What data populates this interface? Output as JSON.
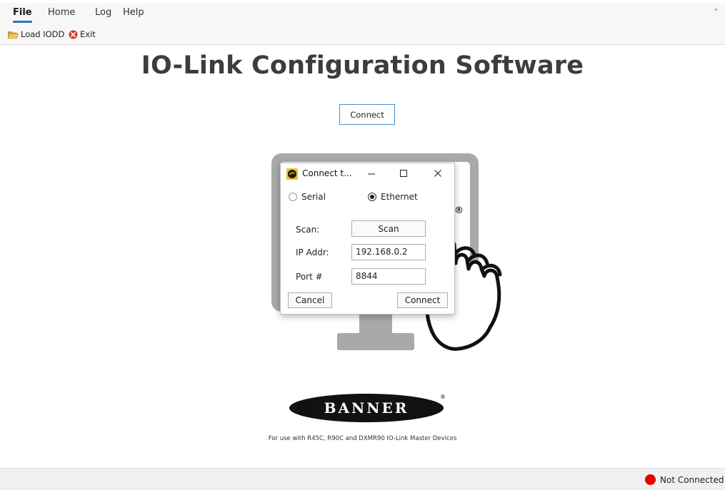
{
  "menu": {
    "tabs": [
      {
        "label": "File",
        "active": true
      },
      {
        "label": "Home",
        "active": false
      },
      {
        "label": "Log",
        "active": false
      },
      {
        "label": "Help",
        "active": false
      }
    ],
    "collapse_icon": "chevron-up-icon"
  },
  "ribbon": {
    "load_iodd": {
      "label": "Load IODD",
      "icon": "folder-open-icon"
    },
    "exit": {
      "label": "Exit",
      "icon": "exit-x-icon"
    }
  },
  "main": {
    "title": "IO-Link Configuration Software",
    "connect_button": "Connect",
    "monitor_mark": "®"
  },
  "dialog": {
    "title": "Connect t...",
    "radio_serial": {
      "label": "Serial",
      "checked": false
    },
    "radio_ethernet": {
      "label": "Ethernet",
      "checked": true
    },
    "scan_label": "Scan:",
    "scan_button": "Scan",
    "ip_label": "IP Addr:",
    "ip_value": "192.168.0.2",
    "port_label": "Port #",
    "port_value": "8844",
    "cancel_button": "Cancel",
    "connect_button": "Connect"
  },
  "footer": {
    "logo_text": "BANNER",
    "logo_mark": "®",
    "note": "For use with R45C, R90C and DXMR90 IO-Link Master Devices"
  },
  "status": {
    "text": "Not Connected",
    "color": "#e00000"
  }
}
